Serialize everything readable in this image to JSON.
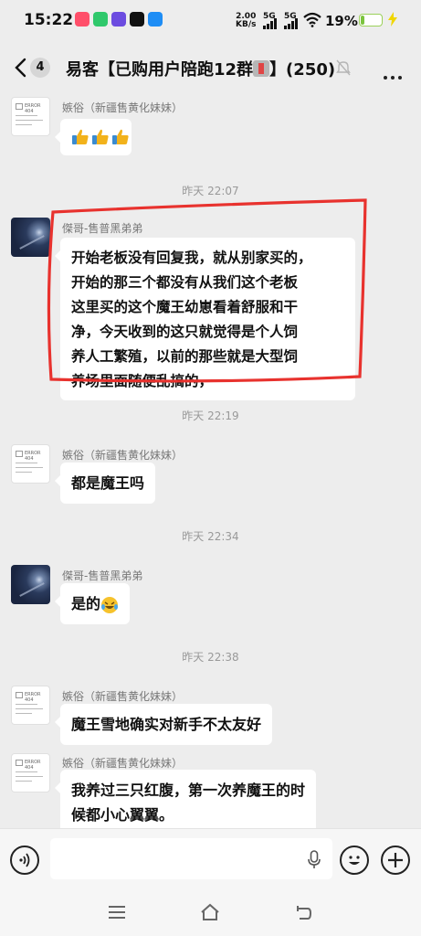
{
  "status_bar": {
    "time": "15:22",
    "net_speed_value": "2.00",
    "net_speed_unit": "KB/s",
    "network_1": "5G",
    "network_2": "5G",
    "battery_percent": "19%",
    "battery_level": 0.19,
    "app_icon_colors": [
      "#ff4f6a",
      "#2fc86b",
      "#6c4ce0",
      "#111111",
      "#1e8df5"
    ]
  },
  "header": {
    "back_icon": "chevron-left-icon",
    "unread_count": "4",
    "title_prefix": "易客【已购用户陪跑12群",
    "title_suffix": "】(250)",
    "mute_icon": "bell-off-icon",
    "more_icon": "more-dots-icon"
  },
  "messages": [
    {
      "type": "message",
      "sender": "嫉俗（新疆售黄化妹妹）",
      "avatar": "error-404-avatar",
      "content": "emoji-thumbs-x3"
    },
    {
      "type": "time",
      "text": "昨天 22:07"
    },
    {
      "type": "message",
      "sender": "傑哥-售普黑弟弟",
      "avatar": "night-sky-avatar",
      "lines": [
        "开始老板没有回复我，就从别家买的，",
        "开始的那三个都没有从我们这个老板",
        "这里买的这个魔王幼崽看着舒服和干",
        "净，今天收到的这只就觉得是个人饲",
        "养人工繁殖，以前的那些就是大型饲",
        "养场里面随便乱搞的，"
      ]
    },
    {
      "type": "time",
      "text": "昨天 22:19"
    },
    {
      "type": "message",
      "sender": "嫉俗（新疆售黄化妹妹）",
      "avatar": "error-404-avatar",
      "text": "都是魔王吗"
    },
    {
      "type": "time",
      "text": "昨天 22:34"
    },
    {
      "type": "message",
      "sender": "傑哥-售普黑弟弟",
      "avatar": "night-sky-avatar",
      "text": "是的",
      "emoji": "laughing-tears-emoji"
    },
    {
      "type": "time",
      "text": "昨天 22:38"
    },
    {
      "type": "message",
      "sender": "嫉俗（新疆售黄化妹妹）",
      "avatar": "error-404-avatar",
      "text": "魔王雪地确实对新手不太友好"
    },
    {
      "type": "message",
      "sender": "嫉俗（新疆售黄化妹妹）",
      "avatar": "error-404-avatar",
      "lines": [
        "我养过三只红腹，第一次养魔王的时",
        "候都小心翼翼。"
      ]
    }
  ],
  "error_avatar_text": "ERROR 404",
  "annotation_color": "#e8322e",
  "input_bar": {
    "voice_icon": "voice-icon",
    "input_value": "",
    "mic_icon": "mic-icon",
    "emoji_icon": "smiley-icon",
    "plus_icon": "plus-icon"
  },
  "nav_bar": [
    "menu-icon",
    "home-icon",
    "back-icon"
  ]
}
